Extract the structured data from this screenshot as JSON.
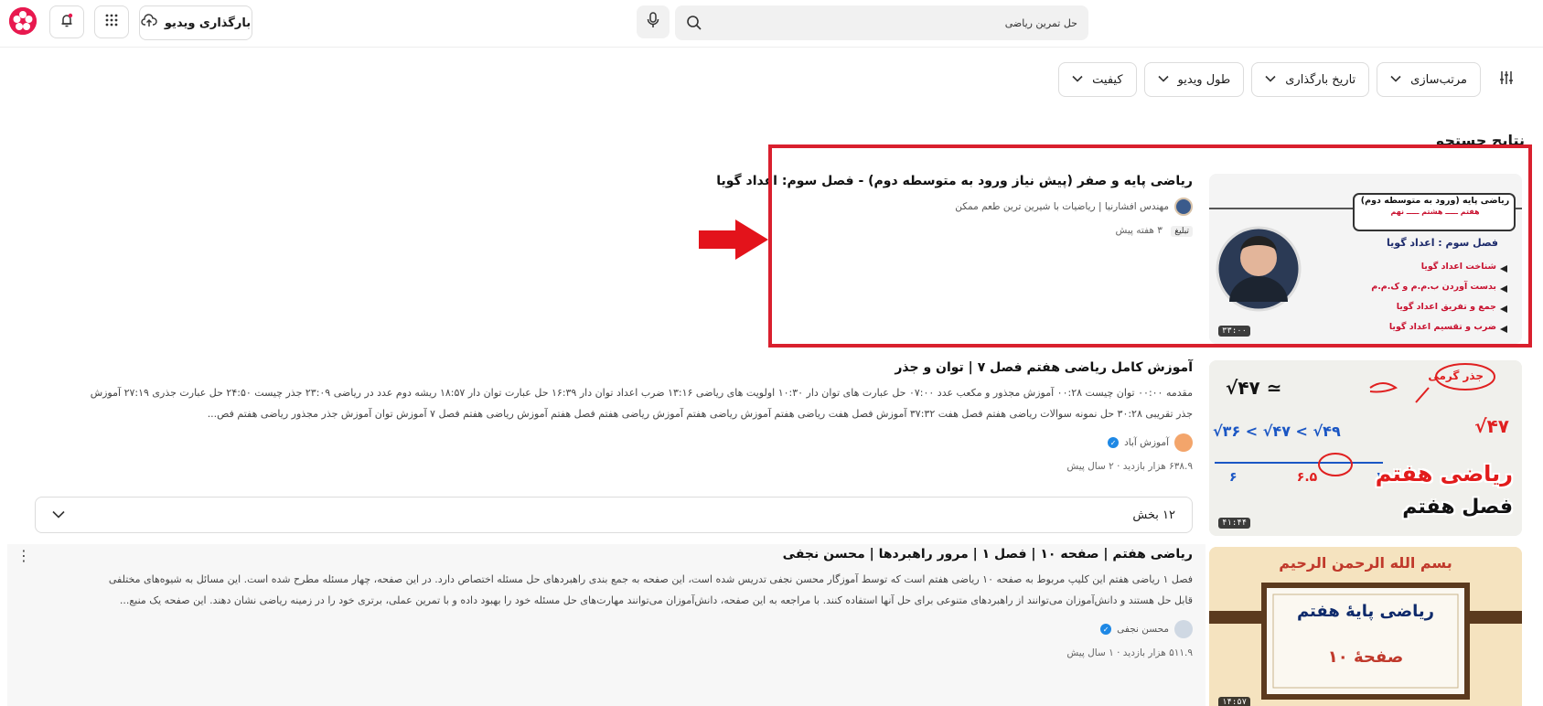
{
  "header": {
    "upload_label": "بارگذاری ویدیو",
    "search_value": "حل تمرین ریاضی",
    "icons": [
      "logo-icon",
      "notification-icon",
      "apps-grid-icon",
      "upload-icon",
      "mic-icon",
      "search-icon"
    ],
    "accent_color": "#e8194f"
  },
  "filters": {
    "items": [
      "مرتب‌سازی",
      "تاریخ بارگذاری",
      "طول ویدیو",
      "کیفیت"
    ],
    "toggle_icon": "sliders-icon"
  },
  "results_title": "نتایج جستجو",
  "results": [
    {
      "title": "ریاضی پایه و صفر (پیش نیاز ورود به متوسطه دوم) - فصل سوم: اعداد گویا",
      "channel": "مهندس افشارنیا | ریاضیات با شیرین ترین طعم ممکن",
      "ad_label": "تبلیغ",
      "time": "۳ هفته پیش",
      "duration": "۳۳:۰۰",
      "thumb": {
        "title_line1": "ریاضی پایه (ورود به متوسطه دوم)",
        "title_line2": "هفتم ـــــ هشتم ـــــ نهم",
        "chapter": "فصل سوم : اعداد گویا",
        "bullets": [
          "شناخت اعداد گویا",
          "بدست آوردن ب.م.م و ک.م.م",
          "جمع و تفریق اعداد گویا",
          "ضرب و تقسیم اعداد گویا"
        ]
      }
    },
    {
      "title": "آموزش کامل ریاضی هفتم فصل ۷ | توان و جذر",
      "description_line1": "مقدمه ۰۰:۰۰ توان چیست ۰۰:۲۸ آموزش مجذور و مکعب عدد ۰۷:۰۰ حل عبارت های توان دار ۱۰:۳۰ اولویت های ریاضی ۱۳:۱۶ ضرب اعداد توان دار ۱۶:۳۹ حل عبارت توان دار ۱۸:۵۷ ریشه دوم عدد در ریاضی ۲۳:۰۹ جذر چیست ۲۴:۵۰ حل عبارت جذری ۲۷:۱۹ آموزش",
      "description_line2": "جذر تقریبی ۳۰:۲۸ حل نمونه سوالات ریاضی هفتم فصل هفت ۳۷:۳۲ آموزش فصل هفت ریاضی هفتم آموزش ریاضی هفتم آموزش ریاضی هفتم فصل هفتم آموزش ریاضی هفتم فصل ۷ آموزش توان آموزش جذر مجذور ریاضی هفتم فص...",
      "channel": "آموزش آباد",
      "views": "۶۳۸.۹ هزار بازدید",
      "time": "۲ سال پیش",
      "duration": "۴۱:۴۴",
      "sections_label": "۱۲ بخش",
      "thumb": {
        "badge": "جذر گرمی",
        "expr_top": "√۴۷ ≃",
        "expr_right": "√۴۷",
        "ineq": "√۳۶ < √۴۷ < √۴۹",
        "frac_bottom": [
          "۶",
          "۶.۵",
          "۷"
        ],
        "grade": "ریاضی هفتم",
        "chapter": "فصل هفتم"
      }
    },
    {
      "title": "ریاضی هفتم | صفحه ۱۰ | فصل ۱ | مرور راهبردها | محسن نجفی",
      "description_line1": "فصل ۱ ریاضی هفتم این کلیپ مربوط به صفحه ۱۰ ریاضی هفتم است که توسط آموزگار محسن نجفی تدریس شده است، این صفحه به جمع بندی راهبردهای حل مسئله اختصاص دارد. در این صفحه، چهار مسئله مطرح شده است. این مسائل به شیوه‌های مختلفی",
      "description_line2": "قابل حل هستند و دانش‌آموزان می‌توانند از راهبردهای متنوعی برای حل آنها استفاده کنند. با مراجعه به این صفحه، دانش‌آموزان می‌توانند مهارت‌های حل مسئله خود را بهبود داده و با تمرین عملی، برتری خود را در زمینه ریاضی نشان دهند. این صفحه یک منبع...",
      "channel": "محسن نجفی",
      "views": "۵۱۱.۹ هزار بازدید",
      "time": "۱ سال پیش",
      "duration": "۱۴:۵۷",
      "thumb": {
        "basmala": "بسم الله الرحمن الرحیم",
        "grade": "ریاضی پایهٔ هفتم",
        "page": "صفحهٔ ۱۰"
      }
    }
  ]
}
